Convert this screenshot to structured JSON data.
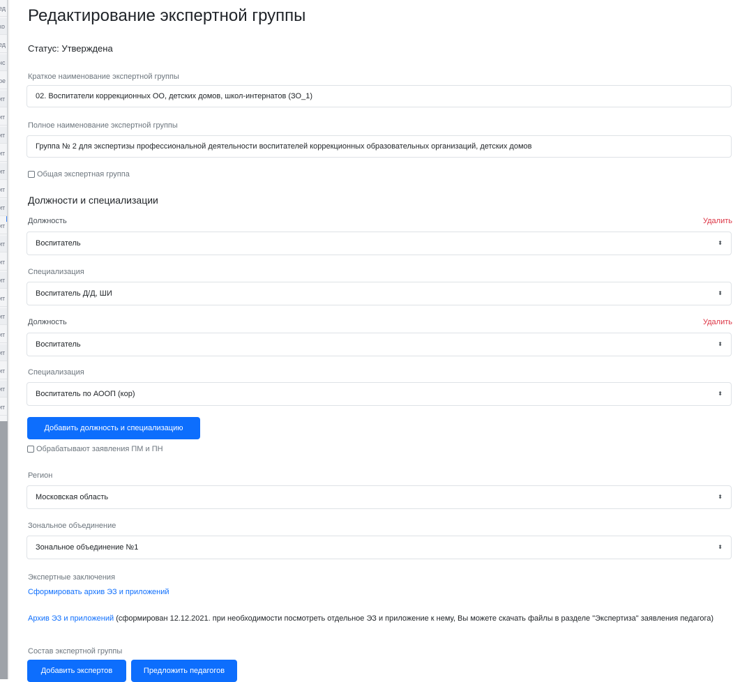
{
  "page": {
    "title": "Редактирование экспертной группы",
    "status": "Статус: Утверждена"
  },
  "short_name": {
    "label": "Краткое наименование экспертной группы",
    "value": "02. Воспитатели коррекционных ОО, детских домов, школ-интернатов (ЗО_1)"
  },
  "full_name": {
    "label": "Полное наименование экспертной группы",
    "value": "Группа № 2 для экспертизы профессиональной деятельности воспитателей коррекционных образовательных организаций, детских домов"
  },
  "common_group_checkbox": {
    "label": "Общая экспертная группа",
    "checked": false
  },
  "positions_section": {
    "title": "Должности и специализации",
    "position_label": "Должность",
    "specialization_label": "Специализация",
    "delete_label": "Удалить",
    "entries": [
      {
        "position": "Воспитатель",
        "specialization": "Воспитатель Д/Д, ШИ"
      },
      {
        "position": "Воспитатель",
        "specialization": "Воспитатель по АООП (кор)"
      }
    ],
    "add_button": "Добавить должность и специализацию"
  },
  "pm_pn_checkbox": {
    "label": "Обрабатывают заявления ПМ и ПН",
    "checked": false
  },
  "region": {
    "label": "Регион",
    "value": "Московская область"
  },
  "zonal": {
    "label": "Зональное объединение",
    "value": "Зональное объединение №1"
  },
  "conclusions": {
    "label": "Экспертные заключения",
    "generate_link": "Сформировать архив ЭЗ и приложений",
    "archive_link": "Архив ЭЗ и приложений",
    "archive_note": " (сформирован 12.12.2021. при необходимости посмотреть отдельное ЭЗ и приложение к нему, Вы можете скачать файлы в разделе \"Экспертиза\" заявления педагога)"
  },
  "composition": {
    "label": "Состав экспертной группы",
    "add_experts_button": "Добавить экспертов",
    "suggest_teachers_button": "Предложить педагогов"
  },
  "background_sidebar_fragments": [
    "ед",
    "ко",
    "ед",
    "нс",
    "ре",
    "ит",
    "ит",
    "ит",
    "ит",
    "ит",
    "ит",
    "ит",
    "ит",
    "ит",
    "ит",
    "ит",
    "ит",
    "ит",
    "ит",
    "ит",
    "ит",
    "ит",
    "ит"
  ],
  "colors": {
    "primary": "#0d6efd",
    "danger": "#dc3545",
    "border": "#dee2e6",
    "muted_text": "#6c757d"
  },
  "icons": {
    "select_caret": "⬍"
  }
}
